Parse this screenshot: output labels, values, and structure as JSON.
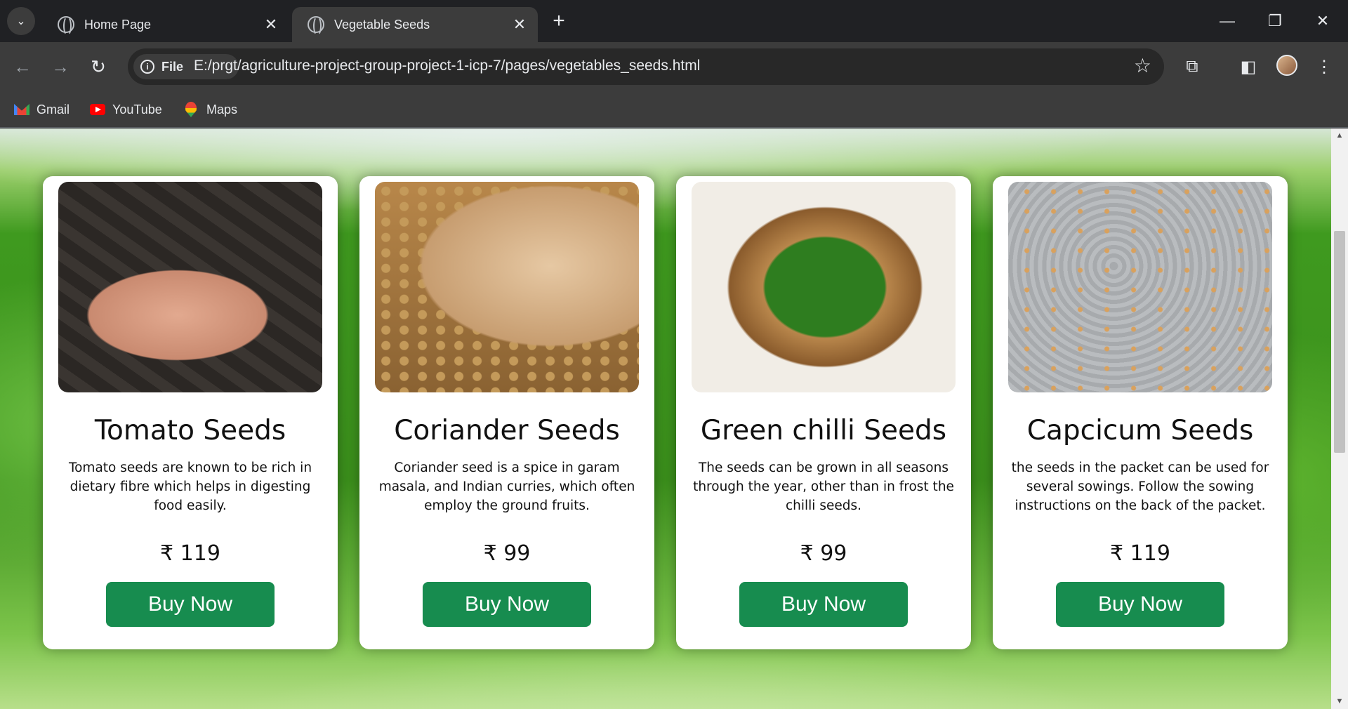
{
  "browser": {
    "tabs": [
      {
        "title": "Home Page",
        "active": false
      },
      {
        "title": "Vegetable Seeds",
        "active": true
      }
    ],
    "address": {
      "chip": "File",
      "url": "E:/prgt/agriculture-project-group-project-1-icp-7/pages/vegetables_seeds.html"
    },
    "bookmarks": [
      "Gmail",
      "YouTube",
      "Maps"
    ]
  },
  "products": [
    {
      "name": "Tomato Seeds",
      "description": "Tomato seeds are known to be rich in dietary fibre which helps in digesting food easily.",
      "price": "₹ 119",
      "button": "Buy Now"
    },
    {
      "name": "Coriander Seeds",
      "description": "Coriander seed is a spice in garam masala, and Indian curries, which often employ the ground fruits.",
      "price": "₹ 99",
      "button": "Buy Now"
    },
    {
      "name": "Green chilli Seeds",
      "description": "The seeds can be grown in all seasons through the year, other than in frost the chilli seeds.",
      "price": "₹ 99",
      "button": "Buy Now"
    },
    {
      "name": "Capcicum Seeds",
      "description": "the seeds in the packet can be used for several sowings. Follow the sowing instructions on the back of the packet.",
      "price": "₹ 119",
      "button": "Buy Now"
    }
  ],
  "colors": {
    "button": "#178c4f",
    "card": "#ffffff",
    "chrome_dark": "#202124",
    "chrome_toolbar": "#3c3c3c"
  }
}
